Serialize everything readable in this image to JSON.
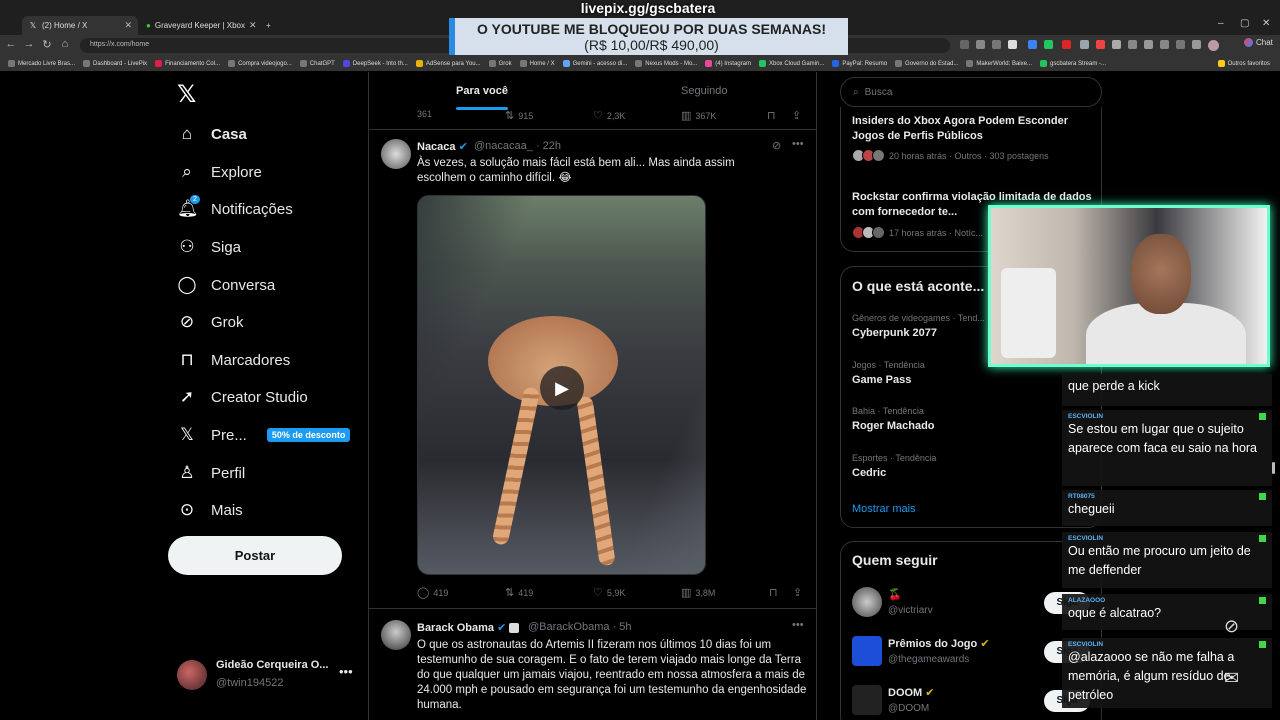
{
  "browser": {
    "tabs": [
      {
        "label": "(2) Home / X"
      },
      {
        "label": "Graveyard Keeper | Xbox"
      }
    ],
    "url": "https://x.com/home",
    "bookmarks": [
      "Mercado Livre Bras...",
      "Dashboard - LivePix",
      "Financiamento Col...",
      "Compra videojogo...",
      "ChatGPT",
      "DeepSeek - Into th...",
      "AdSense para You...",
      "Grok",
      "Home / X",
      "Gemini - acesso di...",
      "Nexus Mods - Mo...",
      "(4) Instagram",
      "Xbox Cloud Gamin...",
      "PayPal: Resumo",
      "Governo do Estad...",
      "MakerWorld: Baixe...",
      "gscbatera Stream -..."
    ],
    "bookmarks_other": "Outros favoritos",
    "chat_button": "Chat"
  },
  "overlay": {
    "url": "livepix.gg/gscbatera",
    "banner_line1": "O YOUTUBE ME BLOQUEOU POR DUAS SEMANAS!",
    "banner_line2": "(R$ 10,00/R$ 490,00)"
  },
  "sidebar": {
    "items": [
      {
        "label": "Casa",
        "icon": "home-icon"
      },
      {
        "label": "Explore",
        "icon": "search-icon"
      },
      {
        "label": "Notificações",
        "icon": "bell-icon",
        "badge": "2"
      },
      {
        "label": "Siga",
        "icon": "follow-icon"
      },
      {
        "label": "Conversa",
        "icon": "chat-icon"
      },
      {
        "label": "Grok",
        "icon": "grok-icon"
      },
      {
        "label": "Marcadores",
        "icon": "bookmark-icon"
      },
      {
        "label": "Creator Studio",
        "icon": "rocket-icon"
      },
      {
        "label": "Pre...",
        "icon": "x-icon",
        "promo": "50% de desconto"
      },
      {
        "label": "Perfil",
        "icon": "person-icon"
      },
      {
        "label": "Mais",
        "icon": "more-icon"
      }
    ],
    "post_button": "Postar",
    "profile": {
      "name": "Gideão Cerqueira O...",
      "handle": "@twin194522"
    }
  },
  "feed": {
    "tabs": [
      "Para você",
      "Seguindo"
    ],
    "prev_actions": {
      "replies": "361",
      "reposts": "915",
      "likes": "2,3K",
      "views": "367K"
    },
    "tweets": [
      {
        "name": "Nacaca",
        "handle": "@nacacaa_",
        "time": "· 22h",
        "text": "Às vezes, a solução mais fácil está bem ali... Mas ainda assim escolhem o caminho difícil. 😂",
        "replies": "419",
        "reposts": "419",
        "likes": "5,9K",
        "views": "3,8M"
      },
      {
        "name": "Barack Obama",
        "handle": "@BarackObama",
        "time": "· 5h",
        "text": "O que os astronautas do Artemis II fizeram nos últimos 10 dias foi um testemunho de sua coragem. E o fato de terem viajado mais longe da Terra do que qualquer um jamais viajou, reentrado em nossa atmosfera a mais de 24.000 mph e pousado em segurança foi um testemunho da engenhosidade humana."
      }
    ]
  },
  "right": {
    "search_placeholder": "Busca",
    "news": [
      {
        "title": "Insiders do Xbox Agora Podem Esconder Jogos de Perfis Públicos",
        "meta": "20 horas atrás · Outros · 303 postagens"
      },
      {
        "title": "Rockstar confirma violação limitada de dados com fornecedor te...",
        "meta": "17 horas atrás · Notíc..."
      }
    ],
    "trends_title": "O que está aconte...",
    "trends": [
      {
        "category": "Gêneros de videogames · Tend...",
        "name": "Cyberpunk 2077"
      },
      {
        "category": "Jogos · Tendência",
        "name": "Game Pass"
      },
      {
        "category": "Bahia · Tendência",
        "name": "Roger Machado"
      },
      {
        "category": "Esportes · Tendência",
        "name": "Cedric"
      }
    ],
    "show_more": "Mostrar mais",
    "follow_title": "Quem seguir",
    "follow": [
      {
        "name": "🍒",
        "handle": "@victriarv",
        "button": "Siga"
      },
      {
        "name": "Prêmios do Jogo",
        "handle": "@thegameawards",
        "button": "Siga"
      },
      {
        "name": "DOOM",
        "handle": "@DOOM",
        "button": "Siga"
      }
    ]
  },
  "chat": [
    {
      "user": "",
      "text": "que perde a kick"
    },
    {
      "user": "ESCVIOLIN",
      "text": "Se estou em lugar que o sujeito aparece com faca eu saio na hora"
    },
    {
      "user": "RT08075",
      "text": "chegueii"
    },
    {
      "user": "ESCVIOLIN",
      "text": "Ou então me procuro um jeito de me deffender"
    },
    {
      "user": "ALAZAOOO",
      "text": "oque é alcatrao?"
    },
    {
      "user": "ESCVIOLIN",
      "text": "@alazaooo se não me falha a memória, é algum resíduo de petróleo"
    }
  ],
  "colors": {
    "accent": "#1d9bf0",
    "cam_border": "#6fffcf",
    "background": "#000000"
  }
}
